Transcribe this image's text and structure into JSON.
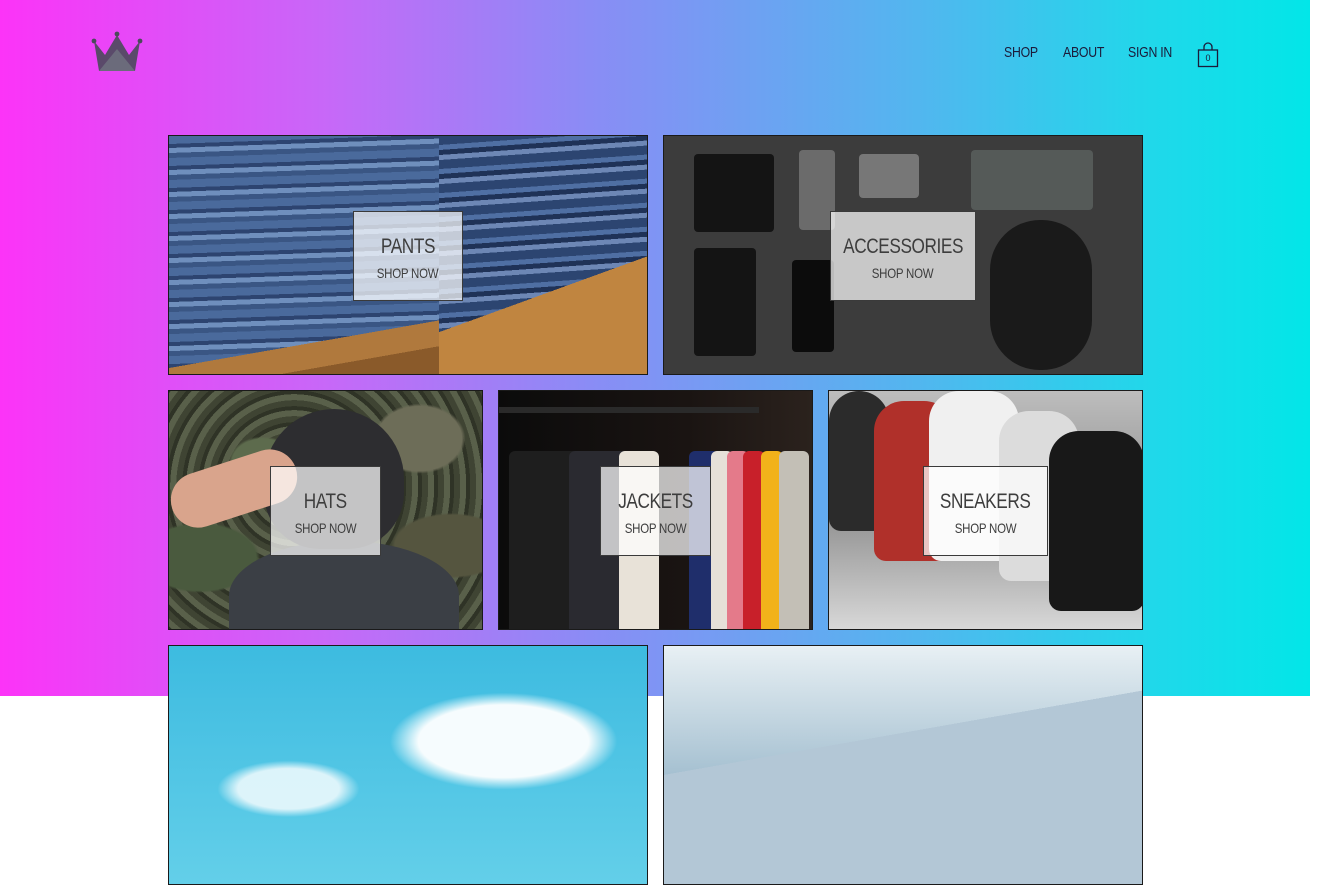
{
  "nav": {
    "links": [
      "SHOP",
      "ABOUT",
      "SIGN IN"
    ],
    "cart_count": "0"
  },
  "categories": [
    {
      "title": "PANTS",
      "cta": "SHOP NOW"
    },
    {
      "title": "ACCESSORIES",
      "cta": "SHOP NOW"
    },
    {
      "title": "HATS",
      "cta": "SHOP NOW"
    },
    {
      "title": "JACKETS",
      "cta": "SHOP NOW"
    },
    {
      "title": "SNEAKERS",
      "cta": "SHOP NOW"
    }
  ],
  "icons": {
    "logo": "crown-icon",
    "cart": "shopping-bag-icon"
  },
  "colors": {
    "gradient_start": "#fc33f8",
    "gradient_end": "#02e6e8",
    "text": "#1b1b3a"
  }
}
